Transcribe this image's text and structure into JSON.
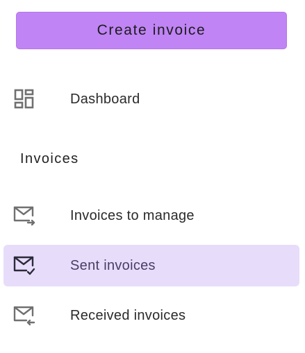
{
  "sidebar": {
    "create_button": {
      "label": "Create invoice"
    },
    "dashboard": {
      "label": "Dashboard",
      "icon": "dashboard-icon"
    },
    "section_heading": "Invoices",
    "items": [
      {
        "label": "Invoices to manage",
        "icon": "mail-forward-icon",
        "active": false
      },
      {
        "label": "Sent invoices",
        "icon": "mail-check-icon",
        "active": true
      },
      {
        "label": "Received invoices",
        "icon": "mail-receive-icon",
        "active": false
      }
    ]
  },
  "colors": {
    "accent": "#c084f5",
    "active_background": "#e8dcfb",
    "icon_gray": "#707070",
    "icon_dark": "#2b2b3a"
  }
}
